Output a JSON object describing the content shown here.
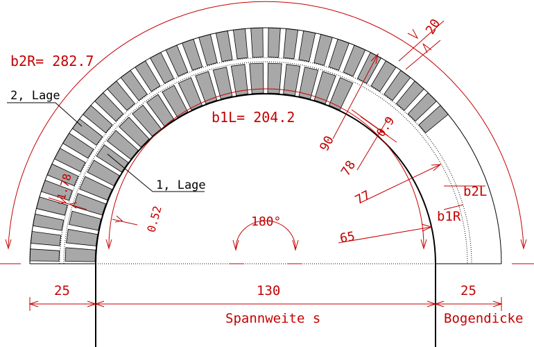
{
  "labels": {
    "b2R": "b2R= 282.7",
    "lage2": "2, Lage",
    "dim20": "20",
    "b1L": "b1L= 204.2",
    "dim09": "0.9",
    "dim90": "90",
    "dim78": "78",
    "dim77": "77",
    "b2L": "b2L",
    "dim178": "1.78",
    "lage1": "1, Lage",
    "dim052": "0.52",
    "angle": "180°",
    "dim65": "65",
    "b1R": "b1R",
    "left25": "25",
    "span130": "130",
    "right25": "25",
    "spannweite": "Spannweite s",
    "bogendicke": "Bogendicke"
  },
  "colors": {
    "dimension": "#c40000",
    "brick": "#a8a8a8",
    "outline": "#000000"
  }
}
